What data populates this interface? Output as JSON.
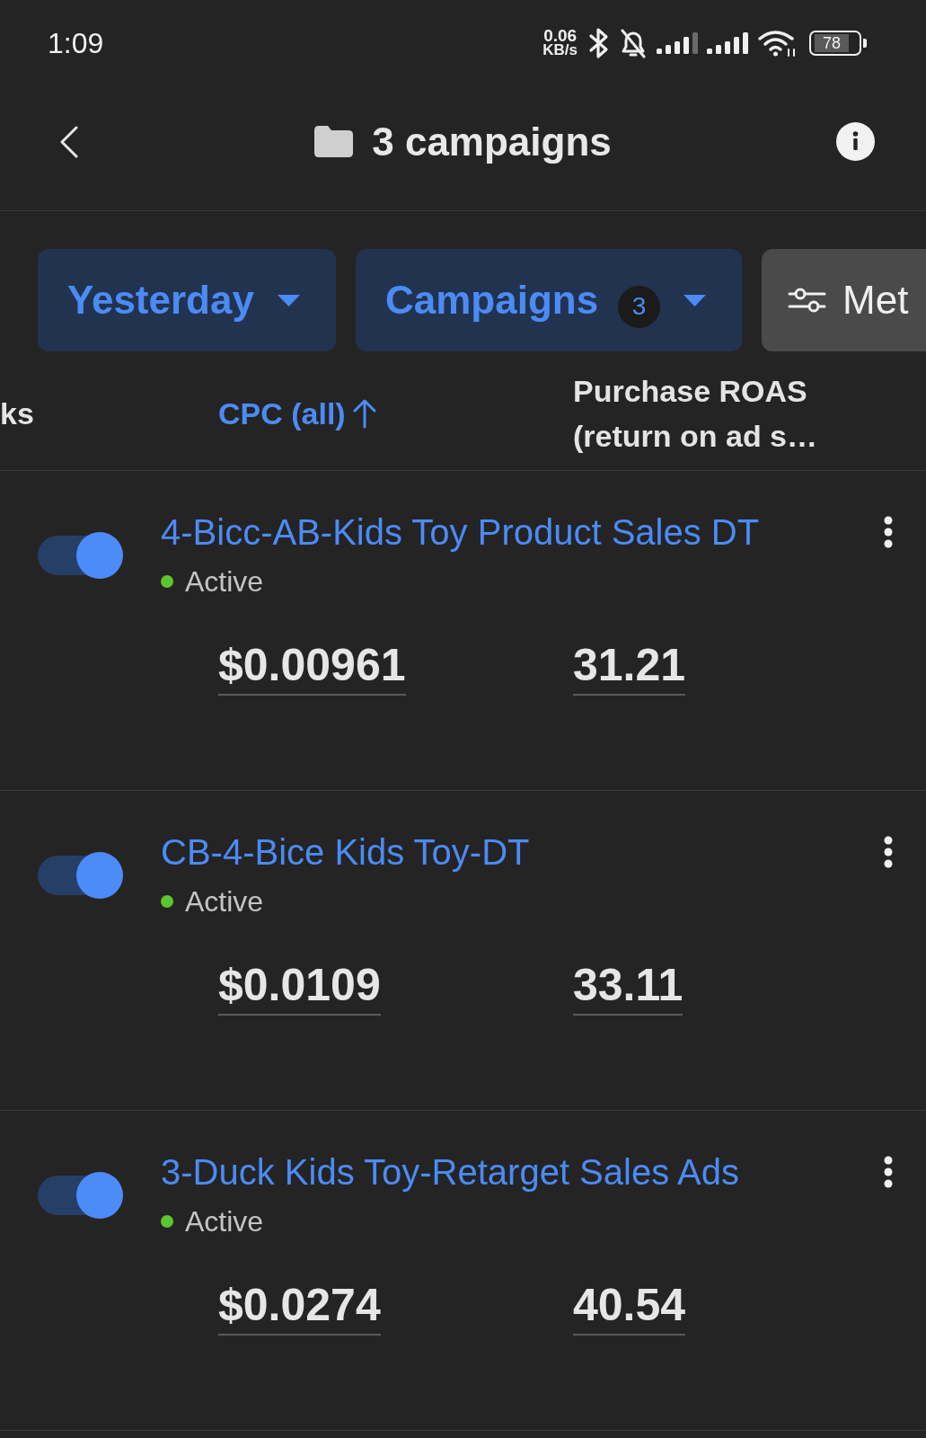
{
  "status_bar": {
    "time": "1:09",
    "net_speed": "0.06",
    "net_speed_unit": "KB/s",
    "battery": "78"
  },
  "header": {
    "title": "3 campaigns"
  },
  "filters": [
    {
      "kind": "dropdown",
      "label": "Yesterday"
    },
    {
      "kind": "dropdown",
      "label": "Campaigns",
      "badge": "3"
    },
    {
      "kind": "metrics",
      "label": "Met"
    }
  ],
  "columns": [
    {
      "label": "ks",
      "sorted": false
    },
    {
      "label": "CPC (all)",
      "sorted": true
    },
    {
      "label": "Purchase ROAS (return on ad s…",
      "sorted": false
    }
  ],
  "rows": [
    {
      "name": "4-Bicc-AB-Kids Toy Product Sales DT",
      "on": true,
      "status": "Active",
      "cpc": "$0.00961",
      "roas": "31.21"
    },
    {
      "name": "CB-4-Bice Kids Toy-DT",
      "on": true,
      "status": "Active",
      "cpc": "$0.0109",
      "roas": "33.11"
    },
    {
      "name": "3-Duck Kids Toy-Retarget Sales Ads",
      "on": true,
      "status": "Active",
      "cpc": "$0.0274",
      "roas": "40.54"
    }
  ]
}
